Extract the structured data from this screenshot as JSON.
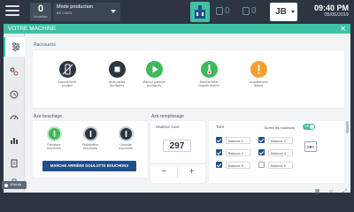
{
  "topbar": {
    "counter_value": "0",
    "counter_label": "Bouteilles",
    "mode_title": "Mode production",
    "mode_status": "en cours",
    "alarm_1_count": "0",
    "alarm_2_count": "0",
    "user_initials": "JB",
    "time": "09:40 PM",
    "date": "05/05/2019"
  },
  "panel": {
    "title": "VOTRE MACHINE",
    "shortcuts_label": "Raccourcis",
    "shortcuts": [
      {
        "label_1": "Marche/Arrêt",
        "label_2": "portillon",
        "icon": "no-bottle-icon"
      },
      {
        "label_1": "Arrêt partiel",
        "label_2": "Auxiliaires",
        "icon": "stop-icon"
      },
      {
        "label_1": "Marche partielle",
        "label_2": "Auxiliaires",
        "icon": "play-icon"
      },
      {
        "label_1": "Marche/Arrêt",
        "label_2": "Chauffe thermo",
        "icon": "thermometer-icon"
      },
      {
        "label_1": "Acquittement",
        "label_2": "défaut",
        "icon": "warning-icon"
      }
    ],
    "bouchage_label": "Axe bouchage",
    "bouchage": [
      {
        "label_1": "Élévateur",
        "label_2": "bouchons"
      },
      {
        "label_1": "Distributeur",
        "label_2": "bouchons"
      },
      {
        "label_1": "Goulotte",
        "label_2": "bouchons"
      }
    ],
    "goulotte_button": "MARCHE ARRIÈRE GOULOTTE BOUCHONS",
    "remplissage_label": "Axe remplissage",
    "hauteur_label": "Hauteur cuve",
    "hauteur_value": "297",
    "minus": "−",
    "plus": "+",
    "tare_label": "Tare",
    "all_balances_label": "Toutes les balances",
    "toggle_label": "ON",
    "zero_label": ">0<",
    "balances": [
      {
        "name": "Balance 1",
        "checked": true
      },
      {
        "name": "Balance 2",
        "checked": true
      },
      {
        "name": "Balance 3",
        "checked": true
      },
      {
        "name": "Balance 4",
        "checked": true
      },
      {
        "name": "Balance 5",
        "checked": true
      },
      {
        "name": "Balance 6",
        "checked": false
      }
    ]
  },
  "bottom": {
    "status_label": "Etat du"
  },
  "colors": {
    "accent": "#3fc1a4",
    "dark": "#2c3540",
    "green": "#3fb95a",
    "navy": "#1f4f8c",
    "orange": "#f0a030"
  }
}
